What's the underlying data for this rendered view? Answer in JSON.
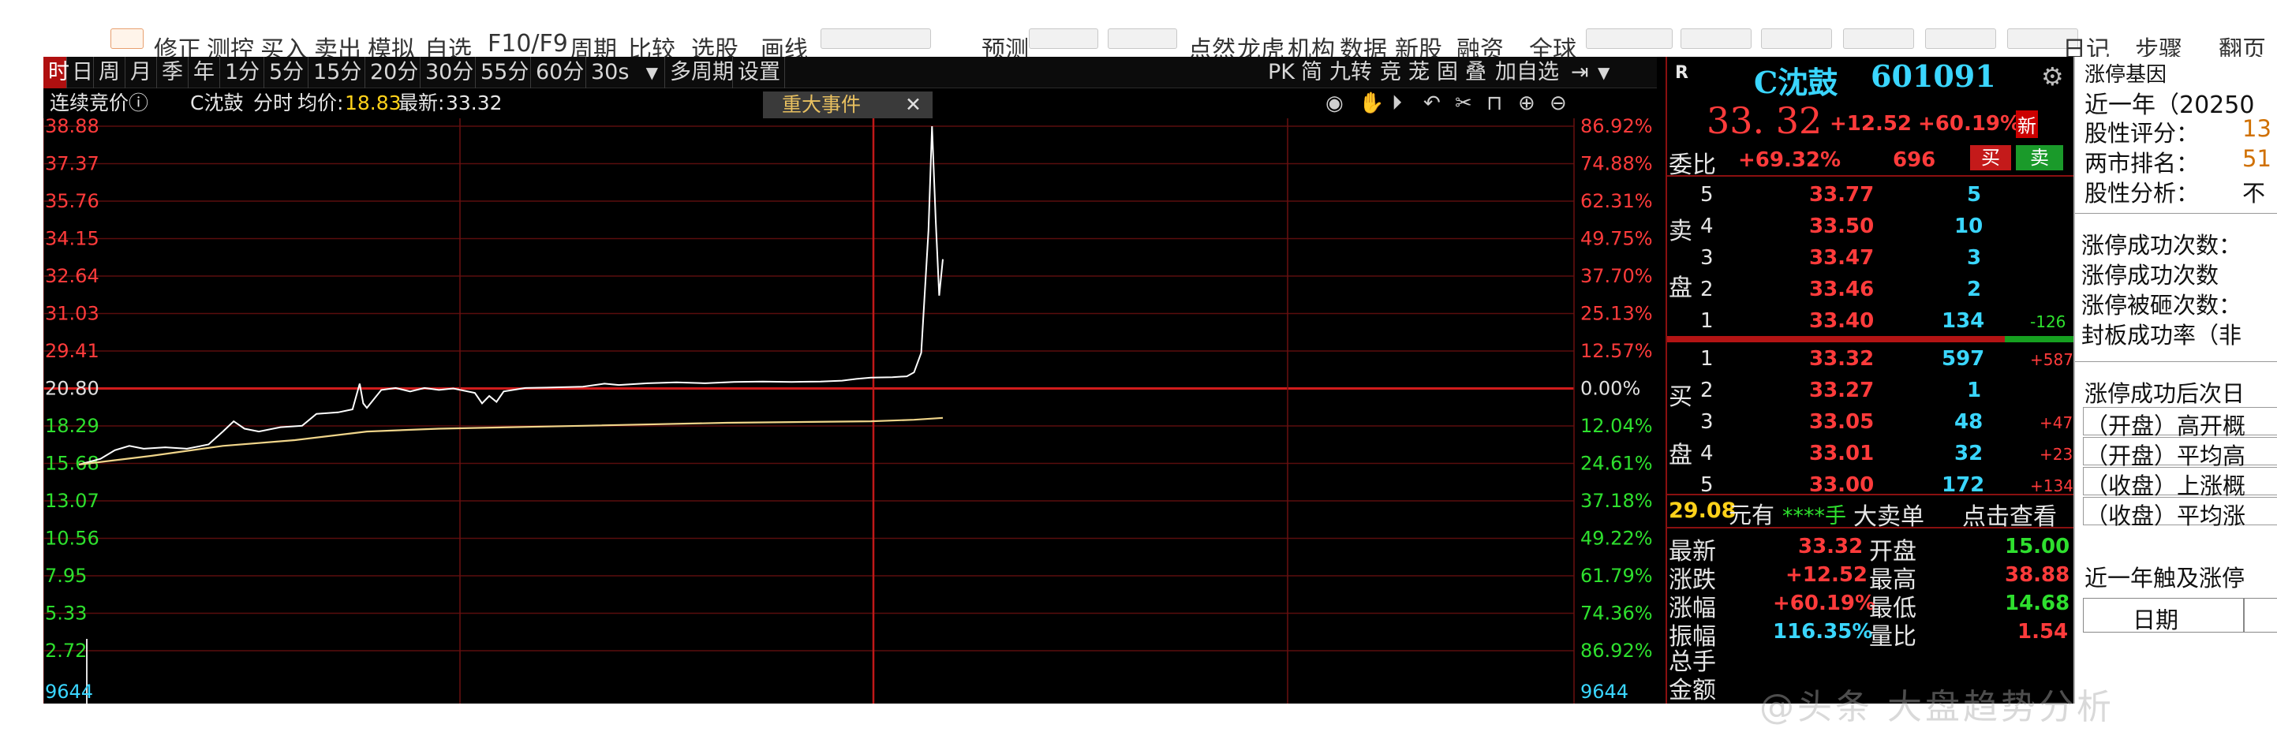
{
  "menubar": {
    "items": [
      "修正",
      "测控",
      "买入",
      "卖出",
      "模拟",
      "自选",
      "F10/F9",
      "周期",
      "比较",
      "选股",
      "画线",
      "预测",
      "点然",
      "龙虎",
      "机构",
      "数据",
      "新股",
      "融资",
      "全球",
      "日记",
      "步骤",
      "翻页"
    ]
  },
  "period_tabs": [
    "时",
    "日",
    "周",
    "月",
    "季",
    "年",
    "1分",
    "5分",
    "15分",
    "20分",
    "30分",
    "55分",
    "60分",
    "30s",
    "多周期",
    "设置"
  ],
  "right_tools": [
    "PK",
    "简",
    "九转",
    "竞",
    "茏",
    "固",
    "叠",
    "加自选"
  ],
  "info": {
    "auction": "连续竞价ⓘ",
    "stock_short": "C沈鼓",
    "view": "分时",
    "avg_label": "均价:",
    "avg_value": "18.83",
    "latest_label": "最新:",
    "latest_value": "33.32",
    "event_chip": "重大事件",
    "event_close": "✕"
  },
  "chart_data": {
    "type": "line",
    "title": "",
    "y_ticks_left": [
      "38.88",
      "37.37",
      "35.76",
      "34.15",
      "32.64",
      "31.03",
      "29.41",
      "20.80",
      "18.29",
      "15.68",
      "13.07",
      "10.56",
      "7.95",
      "5.33",
      "2.72"
    ],
    "y_ticks_right": [
      "86.92%",
      "74.88%",
      "62.31%",
      "49.75%",
      "37.70%",
      "25.13%",
      "12.57%",
      "0.00%",
      "12.04%",
      "24.61%",
      "37.18%",
      "49.22%",
      "61.79%",
      "74.36%",
      "86.92%"
    ],
    "volume_label_left": "9644",
    "volume_label_right": "9644",
    "prev_close": 20.8,
    "ylim": [
      2.72,
      38.88
    ],
    "series": [
      {
        "color": "#ffffff",
        "points": [
          [
            0,
            15.6
          ],
          [
            6,
            16.0
          ],
          [
            10,
            16.6
          ],
          [
            14,
            16.9
          ],
          [
            18,
            16.7
          ],
          [
            24,
            16.8
          ],
          [
            30,
            16.7
          ],
          [
            36,
            17.0
          ],
          [
            40,
            17.9
          ],
          [
            43,
            18.6
          ],
          [
            46,
            18.1
          ],
          [
            50,
            17.9
          ],
          [
            56,
            18.2
          ],
          [
            62,
            18.3
          ],
          [
            66,
            19.1
          ],
          [
            72,
            19.2
          ],
          [
            76,
            19.4
          ],
          [
            78,
            21.9
          ],
          [
            79,
            19.8
          ],
          [
            80,
            19.5
          ],
          [
            84,
            20.7
          ],
          [
            88,
            20.9
          ],
          [
            92,
            20.6
          ],
          [
            96,
            20.9
          ],
          [
            100,
            20.7
          ],
          [
            104,
            20.8
          ],
          [
            110,
            20.5
          ],
          [
            112,
            19.8
          ],
          [
            114,
            20.3
          ],
          [
            116,
            19.9
          ],
          [
            118,
            20.6
          ],
          [
            124,
            20.9
          ],
          [
            130,
            21.0
          ],
          [
            140,
            21.2
          ],
          [
            146,
            21.9
          ],
          [
            150,
            21.6
          ],
          [
            158,
            22.0
          ],
          [
            166,
            22.2
          ],
          [
            174,
            22.0
          ],
          [
            182,
            22.3
          ],
          [
            190,
            22.4
          ],
          [
            198,
            22.3
          ],
          [
            206,
            22.4
          ],
          [
            212,
            22.6
          ],
          [
            216,
            23.0
          ],
          [
            220,
            23.3
          ],
          [
            226,
            23.4
          ],
          [
            230,
            23.6
          ],
          [
            232,
            24.5
          ],
          [
            234,
            29.0
          ],
          [
            236,
            34.5
          ],
          [
            237,
            38.88
          ],
          [
            238,
            35.0
          ],
          [
            239,
            31.8
          ],
          [
            240,
            33.32
          ]
        ]
      },
      {
        "color": "#f0d58a",
        "points": [
          [
            0,
            15.6
          ],
          [
            20,
            16.2
          ],
          [
            40,
            16.9
          ],
          [
            60,
            17.3
          ],
          [
            80,
            17.9
          ],
          [
            100,
            18.1
          ],
          [
            140,
            18.3
          ],
          [
            180,
            18.5
          ],
          [
            220,
            18.6
          ],
          [
            232,
            18.7
          ],
          [
            240,
            18.83
          ]
        ]
      }
    ]
  },
  "quote": {
    "badge": "R",
    "name": "C沈鼓",
    "code": "601091",
    "price": "33. 32",
    "change": "+12.52",
    "change_pct": "+60.19%",
    "new_tag": "新",
    "weibi_label": "委比",
    "weibi_value": "+69.32%",
    "weibi_diff": "696",
    "buy_btn": "买",
    "sell_btn": "卖",
    "sell_side_label": [
      "卖",
      "盘"
    ],
    "buy_side_label": [
      "买",
      "盘"
    ],
    "asks": [
      {
        "lvl": "5",
        "price": "33.77",
        "vol": "5",
        "chg": ""
      },
      {
        "lvl": "4",
        "price": "33.50",
        "vol": "10",
        "chg": ""
      },
      {
        "lvl": "3",
        "price": "33.47",
        "vol": "3",
        "chg": ""
      },
      {
        "lvl": "2",
        "price": "33.46",
        "vol": "2",
        "chg": ""
      },
      {
        "lvl": "1",
        "price": "33.40",
        "vol": "134",
        "chg": "-126"
      }
    ],
    "bids": [
      {
        "lvl": "1",
        "price": "33.32",
        "vol": "597",
        "chg": "+587"
      },
      {
        "lvl": "2",
        "price": "33.27",
        "vol": "1",
        "chg": ""
      },
      {
        "lvl": "3",
        "price": "33.05",
        "vol": "48",
        "chg": "+47"
      },
      {
        "lvl": "4",
        "price": "33.01",
        "vol": "32",
        "chg": "+23"
      },
      {
        "lvl": "5",
        "price": "33.00",
        "vol": "172",
        "chg": "+134"
      }
    ],
    "bigorder_amt": "29.08",
    "bigorder_text": "元有",
    "bigorder_stars": "****手",
    "bigorder_label": "大卖单",
    "bigorder_link": "点击查看",
    "stats": [
      {
        "l1": "最新",
        "v1": "33.32",
        "l2": "开盘",
        "v2": "15.00"
      },
      {
        "l1": "涨跌",
        "v1": "+12.52",
        "l2": "最高",
        "v2": "38.88"
      },
      {
        "l1": "涨幅",
        "v1": "+60.19%",
        "l2": "最低",
        "v2": "14.68"
      },
      {
        "l1": "振幅",
        "v1": "116.35%",
        "l2": "量比",
        "v2": "1.54"
      }
    ],
    "extra_labels": [
      "总手",
      "金额"
    ]
  },
  "limitup": {
    "title": "涨停基因",
    "year": "近一年（20250",
    "rows": [
      "股性评分：",
      "两市排名：",
      "股性分析："
    ],
    "row_values": [
      "13",
      "51",
      "不"
    ],
    "stats": [
      "涨停成功次数：",
      "涨停成功次数",
      "涨停被砸次数：",
      "封板成功率（非"
    ],
    "next_day": "涨停成功后次日",
    "items": [
      "（开盘）高开概",
      "（开盘）平均高",
      "（收盘）上涨概",
      "（收盘）平均涨"
    ],
    "touch": "近一年触及涨停",
    "date_header": "日期"
  },
  "watermark": "@头条 大盘趋势分析"
}
